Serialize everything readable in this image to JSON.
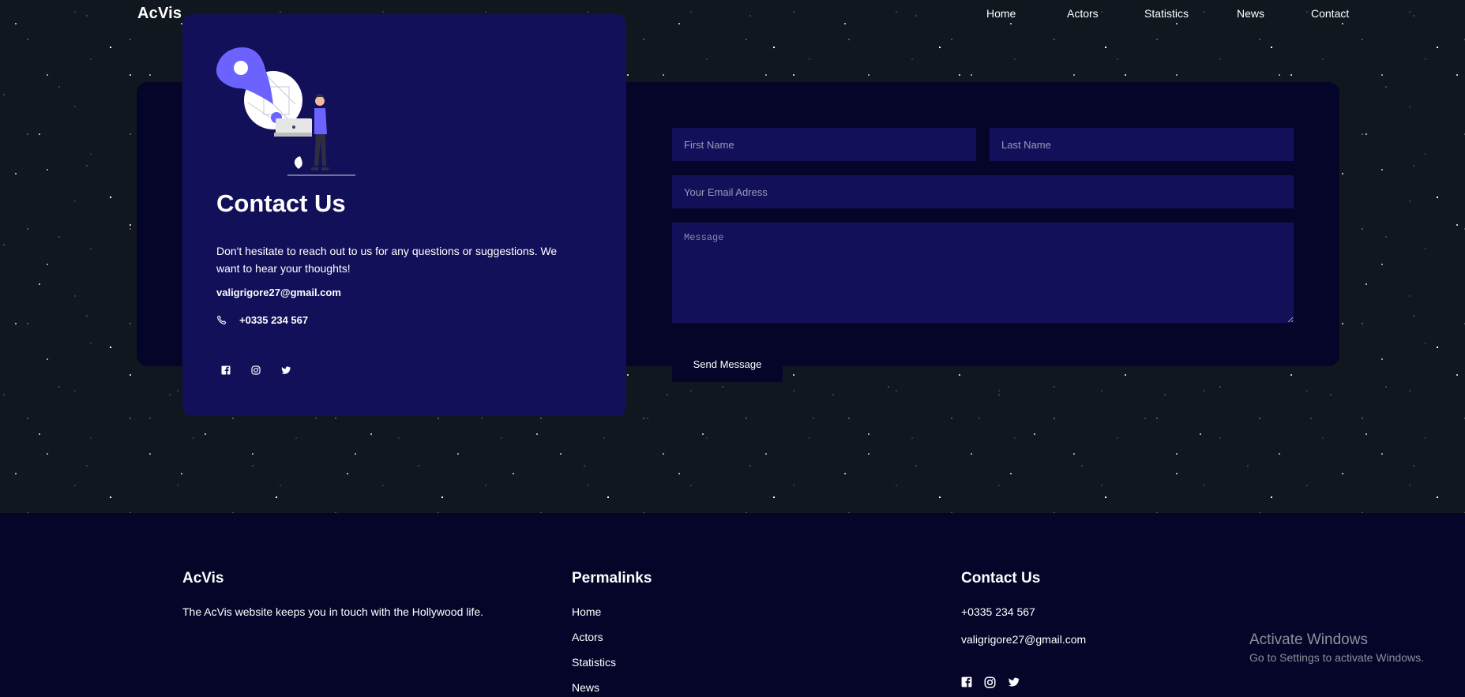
{
  "brand": "AcVis",
  "nav": {
    "items": [
      "Home",
      "Actors",
      "Statistics",
      "News",
      "Contact"
    ]
  },
  "contact_card": {
    "title": "Contact Us",
    "description": "Don't hesitate to reach out to us for any questions or suggestions. We want to hear your thoughts!",
    "email": "valigrigore27@gmail.com",
    "phone": "+0335 234 567",
    "socials": [
      "facebook-icon",
      "instagram-icon",
      "twitter-icon"
    ]
  },
  "form": {
    "first_name_placeholder": "First Name",
    "last_name_placeholder": "Last Name",
    "email_placeholder": "Your Email Adress",
    "message_placeholder": "Message",
    "submit_label": "Send Message"
  },
  "footer": {
    "about_title": "AcVis",
    "about_text": "The AcVis website keeps you in touch with the Hollywood life.",
    "links_title": "Permalinks",
    "links": [
      "Home",
      "Actors",
      "Statistics",
      "News"
    ],
    "contact_title": "Contact Us",
    "phone": "+0335 234 567",
    "email": "valigrigore27@gmail.com",
    "socials": [
      "facebook-icon",
      "instagram-icon",
      "twitter-icon"
    ]
  },
  "os_watermark": {
    "title": "Activate Windows",
    "subtitle": "Go to Settings to activate Windows."
  },
  "colors": {
    "card": "#13105a",
    "panel": "#05052a",
    "accent": "#6c63ff",
    "footer": "#05052a"
  }
}
